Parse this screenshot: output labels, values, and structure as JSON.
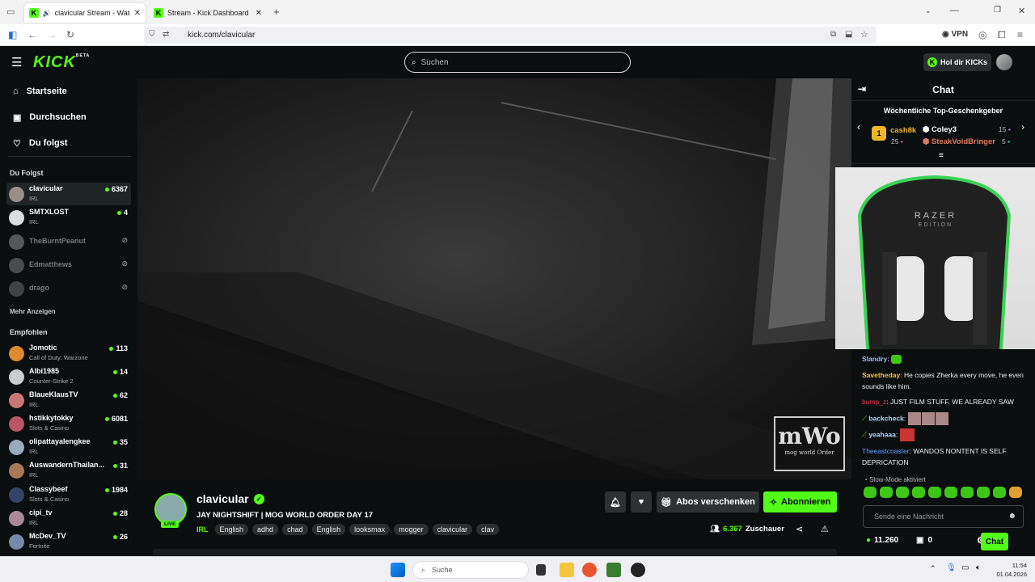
{
  "browser": {
    "tabs": [
      {
        "label": "clavicular Stream - Watch L",
        "active": true
      },
      {
        "label": "Stream - Kick Dashboard",
        "active": false
      }
    ],
    "url": "kick.com/clavicular",
    "vpn_label": "VPN"
  },
  "header": {
    "logo": "KICK",
    "logo_badge": "BETA",
    "search_placeholder": "Suchen",
    "hol_kicks": "Hol dir KICKs"
  },
  "sidebar": {
    "nav": [
      {
        "label": "Startseite",
        "icon": "home-icon"
      },
      {
        "label": "Durchsuchen",
        "icon": "browse-icon"
      },
      {
        "label": "Du folgst",
        "icon": "heart-icon"
      }
    ],
    "following_title": "Du Folgst",
    "following": [
      {
        "name": "clavicular",
        "category": "IRL",
        "viewers": "6367",
        "live": true
      },
      {
        "name": "SMTXLOST",
        "category": "IRL",
        "viewers": "4",
        "live": true
      },
      {
        "name": "TheBurntPeanut",
        "category": "",
        "viewers": "",
        "live": false
      },
      {
        "name": "Edmatthews",
        "category": "",
        "viewers": "",
        "live": false
      },
      {
        "name": "drago",
        "category": "",
        "viewers": "",
        "live": false
      }
    ],
    "show_more": "Mehr Anzeigen",
    "recommended_title": "Empfohlen",
    "recommended": [
      {
        "name": "Jomotic",
        "category": "Call of Duty: Warzone",
        "viewers": "113"
      },
      {
        "name": "Albi1985",
        "category": "Counter-Strike 2",
        "viewers": "14"
      },
      {
        "name": "BlaueKlausTV",
        "category": "IRL",
        "viewers": "62"
      },
      {
        "name": "hstikkytokky",
        "category": "Slots & Casino",
        "viewers": "6081"
      },
      {
        "name": "olipattayalengkee",
        "category": "IRL",
        "viewers": "35"
      },
      {
        "name": "AuswandernThailan...",
        "category": "IRL",
        "viewers": "31"
      },
      {
        "name": "Classybeef",
        "category": "Slots & Casino",
        "viewers": "1984"
      },
      {
        "name": "cipi_tv",
        "category": "IRL",
        "viewers": "28"
      },
      {
        "name": "McDev_TV",
        "category": "Fortnite",
        "viewers": "26"
      }
    ]
  },
  "video": {
    "watermark_top": "mWo",
    "watermark_bottom": "mog world Order"
  },
  "stream": {
    "streamer": "clavicular",
    "live_badge": "LIVE",
    "title": "JAY NIGHTSHIFT | MOG WORLD ORDER DAY 17",
    "category": "IRL",
    "tags": [
      "English",
      "adhd",
      "chad",
      "English",
      "looksmax",
      "mogger",
      "clavicular",
      "clav"
    ],
    "gift_subs_label": "Abos verschenken",
    "subscribe_label": "Abonnieren",
    "viewers": "6.367",
    "viewers_label": "Zuschauer"
  },
  "chat": {
    "title": "Chat",
    "gifters_title": "Wöchentliche Top-Geschenkgeber",
    "gifters": [
      {
        "rank": "1",
        "name": "cash8k",
        "count": "25"
      },
      {
        "name": "Coley3",
        "count": "15"
      },
      {
        "name": "SteakVoidBringer",
        "count": "5"
      }
    ],
    "cam_text_top": "RAZER",
    "cam_text_bottom": "EDITION",
    "messages": [
      {
        "user": "Slandry",
        "color": "#a0b8ff",
        "text": ""
      },
      {
        "user": "Savetheday",
        "color": "#f0c040",
        "text": "He copies Zherka every move, he even sounds like him."
      },
      {
        "user": "bump_z",
        "color": "#e0405a",
        "text": "JUST FILM STUFF. WE ALREADY SAW"
      },
      {
        "user": "backcheck",
        "color": "#b0d8ff",
        "text": ""
      },
      {
        "user": "yeahaaa",
        "color": "#b0d8ff",
        "text": ""
      },
      {
        "user": "Theeastcoaster",
        "color": "#6aa0ff",
        "text": "WANDOS NONTENT IS SELF DEPRICATION"
      }
    ],
    "slow_mode": "Slow-Mode aktiviert",
    "input_placeholder": "Sende eine Nachricht",
    "kicks_balance": "11.260",
    "gift_count": "0",
    "send_label": "Chat"
  },
  "taskbar": {
    "search_placeholder": "Suche",
    "time": "11:54",
    "date": "01.04.2026"
  }
}
